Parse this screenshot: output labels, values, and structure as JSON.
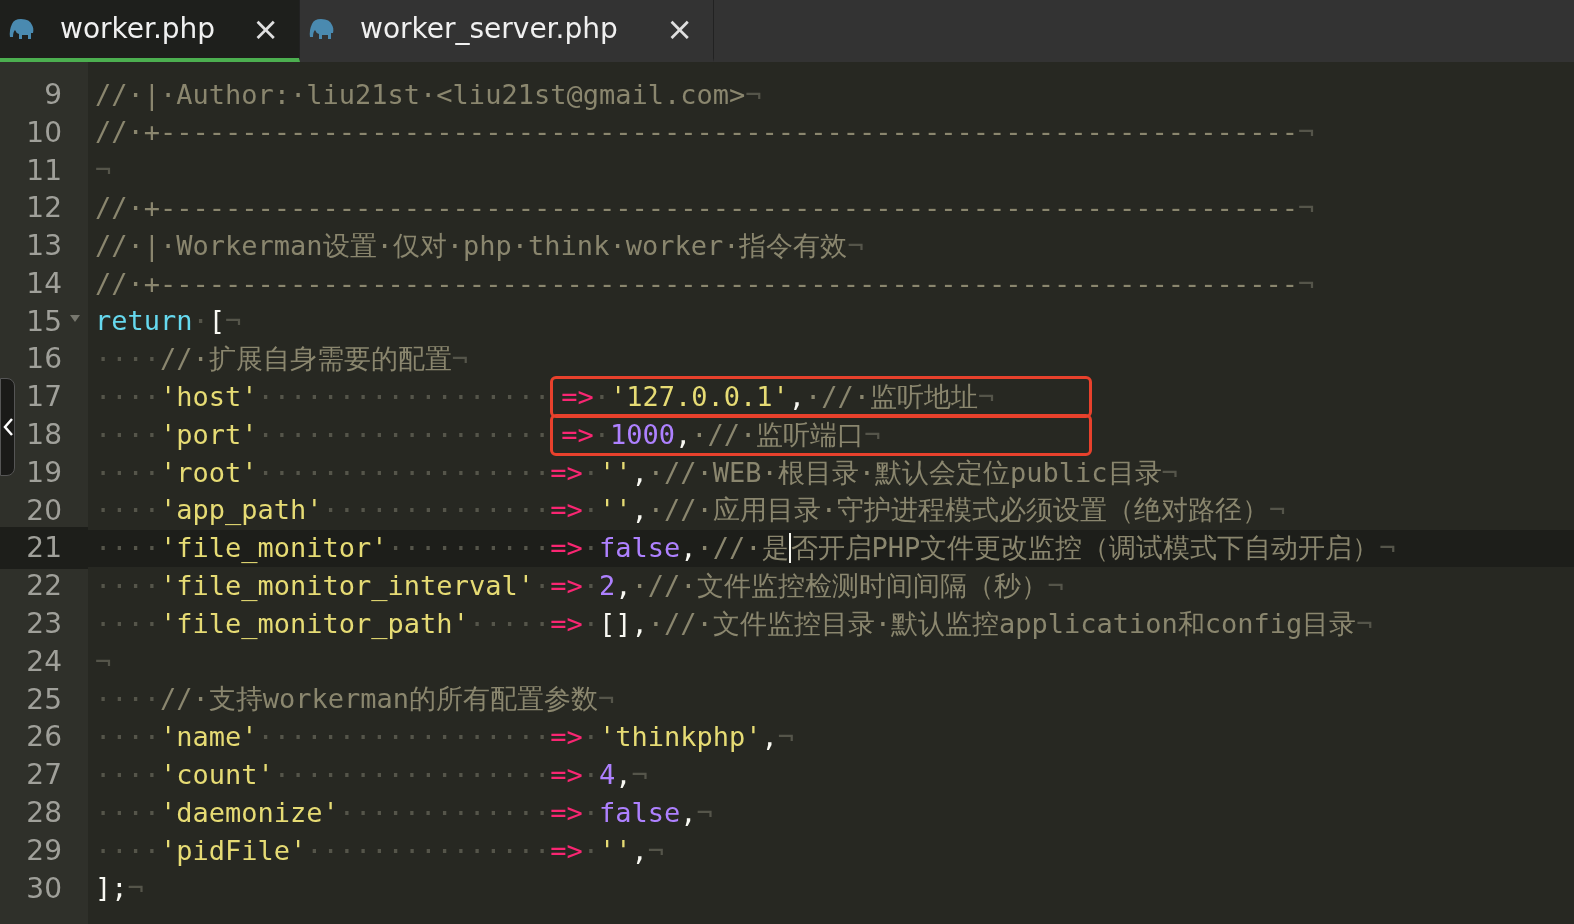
{
  "tabs": [
    {
      "label": "worker.php",
      "selected": true,
      "close": "×"
    },
    {
      "label": "worker_server.php",
      "selected": false,
      "close": "×"
    }
  ],
  "lines": [
    {
      "n": "9",
      "tokens": [
        {
          "kind": "comment",
          "t": "//·|·Author:·liu21st·<liu21st@gmail.com>"
        },
        {
          "kind": "eol",
          "t": "¬"
        }
      ]
    },
    {
      "n": "10",
      "tokens": [
        {
          "kind": "comment",
          "t": "//·+----------------------------------------------------------------------"
        },
        {
          "kind": "eol",
          "t": "¬"
        }
      ]
    },
    {
      "n": "11",
      "tokens": [
        {
          "kind": "eol",
          "t": "¬"
        }
      ]
    },
    {
      "n": "12",
      "tokens": [
        {
          "kind": "comment",
          "t": "//·+----------------------------------------------------------------------"
        },
        {
          "kind": "eol",
          "t": "¬"
        }
      ]
    },
    {
      "n": "13",
      "tokens": [
        {
          "kind": "comment",
          "t": "//·|·Workerman设置·仅对·php·think·worker·指令有效"
        },
        {
          "kind": "eol",
          "t": "¬"
        }
      ]
    },
    {
      "n": "14",
      "tokens": [
        {
          "kind": "comment",
          "t": "//·+----------------------------------------------------------------------"
        },
        {
          "kind": "eol",
          "t": "¬"
        }
      ]
    },
    {
      "n": "15",
      "fold": true,
      "tokens": [
        {
          "kind": "keyword",
          "t": "return"
        },
        {
          "kind": "ws",
          "t": "·"
        },
        {
          "kind": "plain",
          "t": "["
        },
        {
          "kind": "eol",
          "t": "¬"
        }
      ]
    },
    {
      "n": "16",
      "tokens": [
        {
          "kind": "ws",
          "t": "····"
        },
        {
          "kind": "comment",
          "t": "//·扩展自身需要的配置"
        },
        {
          "kind": "eol",
          "t": "¬"
        }
      ]
    },
    {
      "n": "17",
      "boxed": true,
      "tokens": [
        {
          "kind": "ws",
          "t": "····"
        },
        {
          "kind": "string",
          "t": "'host'"
        },
        {
          "kind": "ws",
          "t": "··················"
        },
        {
          "kind": "op",
          "t": "=>"
        },
        {
          "kind": "ws",
          "t": "·"
        },
        {
          "kind": "string",
          "t": "'127.0.0.1'"
        },
        {
          "kind": "plain",
          "t": ","
        },
        {
          "kind": "comment",
          "t": "·//·监听地址"
        },
        {
          "kind": "eol",
          "t": "¬"
        }
      ]
    },
    {
      "n": "18",
      "boxed": true,
      "tokens": [
        {
          "kind": "ws",
          "t": "····"
        },
        {
          "kind": "string",
          "t": "'port'"
        },
        {
          "kind": "ws",
          "t": "··················"
        },
        {
          "kind": "op",
          "t": "=>"
        },
        {
          "kind": "ws",
          "t": "·"
        },
        {
          "kind": "number",
          "t": "1000"
        },
        {
          "kind": "plain",
          "t": ","
        },
        {
          "kind": "comment",
          "t": "·//·监听端口"
        },
        {
          "kind": "eol",
          "t": "¬"
        }
      ]
    },
    {
      "n": "19",
      "tokens": [
        {
          "kind": "ws",
          "t": "····"
        },
        {
          "kind": "string",
          "t": "'root'"
        },
        {
          "kind": "ws",
          "t": "··················"
        },
        {
          "kind": "op",
          "t": "=>"
        },
        {
          "kind": "ws",
          "t": "·"
        },
        {
          "kind": "string",
          "t": "''"
        },
        {
          "kind": "plain",
          "t": ","
        },
        {
          "kind": "comment",
          "t": "·//·WEB·根目录·默认会定位public目录"
        },
        {
          "kind": "eol",
          "t": "¬"
        }
      ]
    },
    {
      "n": "20",
      "tokens": [
        {
          "kind": "ws",
          "t": "····"
        },
        {
          "kind": "string",
          "t": "'app_path'"
        },
        {
          "kind": "ws",
          "t": "··············"
        },
        {
          "kind": "op",
          "t": "=>"
        },
        {
          "kind": "ws",
          "t": "·"
        },
        {
          "kind": "string",
          "t": "''"
        },
        {
          "kind": "plain",
          "t": ","
        },
        {
          "kind": "comment",
          "t": "·//·应用目录·守护进程模式必须设置（绝对路径）"
        },
        {
          "kind": "eol",
          "t": "¬"
        }
      ]
    },
    {
      "n": "21",
      "current": true,
      "tokens": [
        {
          "kind": "ws",
          "t": "····"
        },
        {
          "kind": "string",
          "t": "'file_monitor'"
        },
        {
          "kind": "ws",
          "t": "··········"
        },
        {
          "kind": "op",
          "t": "=>"
        },
        {
          "kind": "ws",
          "t": "·"
        },
        {
          "kind": "number",
          "t": "false"
        },
        {
          "kind": "plain",
          "t": ","
        },
        {
          "kind": "comment",
          "t": "·//·是"
        },
        {
          "kind": "comment",
          "t": "否开启PHP文件更改监控（调试模式下自动开启）",
          "cursor": true
        },
        {
          "kind": "eol",
          "t": "¬"
        }
      ]
    },
    {
      "n": "22",
      "tokens": [
        {
          "kind": "ws",
          "t": "····"
        },
        {
          "kind": "string",
          "t": "'file_monitor_interval'"
        },
        {
          "kind": "ws",
          "t": "·"
        },
        {
          "kind": "op",
          "t": "=>"
        },
        {
          "kind": "ws",
          "t": "·"
        },
        {
          "kind": "number",
          "t": "2"
        },
        {
          "kind": "plain",
          "t": ","
        },
        {
          "kind": "comment",
          "t": "·//·文件监控检测时间间隔（秒）"
        },
        {
          "kind": "eol",
          "t": "¬"
        }
      ]
    },
    {
      "n": "23",
      "tokens": [
        {
          "kind": "ws",
          "t": "····"
        },
        {
          "kind": "string",
          "t": "'file_monitor_path'"
        },
        {
          "kind": "ws",
          "t": "·····"
        },
        {
          "kind": "op",
          "t": "=>"
        },
        {
          "kind": "ws",
          "t": "·"
        },
        {
          "kind": "plain",
          "t": "[]"
        },
        {
          "kind": "plain",
          "t": ","
        },
        {
          "kind": "comment",
          "t": "·//·文件监控目录·默认监控application和config目录"
        },
        {
          "kind": "eol",
          "t": "¬"
        }
      ]
    },
    {
      "n": "24",
      "tokens": [
        {
          "kind": "eol",
          "t": "¬"
        }
      ]
    },
    {
      "n": "25",
      "tokens": [
        {
          "kind": "ws",
          "t": "····"
        },
        {
          "kind": "comment",
          "t": "//·支持workerman的所有配置参数"
        },
        {
          "kind": "eol",
          "t": "¬"
        }
      ]
    },
    {
      "n": "26",
      "tokens": [
        {
          "kind": "ws",
          "t": "····"
        },
        {
          "kind": "string",
          "t": "'name'"
        },
        {
          "kind": "ws",
          "t": "··················"
        },
        {
          "kind": "op",
          "t": "=>"
        },
        {
          "kind": "ws",
          "t": "·"
        },
        {
          "kind": "string",
          "t": "'thinkphp'"
        },
        {
          "kind": "plain",
          "t": ","
        },
        {
          "kind": "eol",
          "t": "¬"
        }
      ]
    },
    {
      "n": "27",
      "tokens": [
        {
          "kind": "ws",
          "t": "····"
        },
        {
          "kind": "string",
          "t": "'count'"
        },
        {
          "kind": "ws",
          "t": "·················"
        },
        {
          "kind": "op",
          "t": "=>"
        },
        {
          "kind": "ws",
          "t": "·"
        },
        {
          "kind": "number",
          "t": "4"
        },
        {
          "kind": "plain",
          "t": ","
        },
        {
          "kind": "eol",
          "t": "¬"
        }
      ]
    },
    {
      "n": "28",
      "tokens": [
        {
          "kind": "ws",
          "t": "····"
        },
        {
          "kind": "string",
          "t": "'daemonize'"
        },
        {
          "kind": "ws",
          "t": "·············"
        },
        {
          "kind": "op",
          "t": "=>"
        },
        {
          "kind": "ws",
          "t": "·"
        },
        {
          "kind": "number",
          "t": "false"
        },
        {
          "kind": "plain",
          "t": ","
        },
        {
          "kind": "eol",
          "t": "¬"
        }
      ]
    },
    {
      "n": "29",
      "tokens": [
        {
          "kind": "ws",
          "t": "····"
        },
        {
          "kind": "string",
          "t": "'pidFile'"
        },
        {
          "kind": "ws",
          "t": "···············"
        },
        {
          "kind": "op",
          "t": "=>"
        },
        {
          "kind": "ws",
          "t": "·"
        },
        {
          "kind": "string",
          "t": "''"
        },
        {
          "kind": "plain",
          "t": ","
        },
        {
          "kind": "eol",
          "t": "¬"
        }
      ]
    },
    {
      "n": "30",
      "tokens": [
        {
          "kind": "plain",
          "t": "];"
        },
        {
          "kind": "eol",
          "t": "¬"
        }
      ]
    }
  ]
}
